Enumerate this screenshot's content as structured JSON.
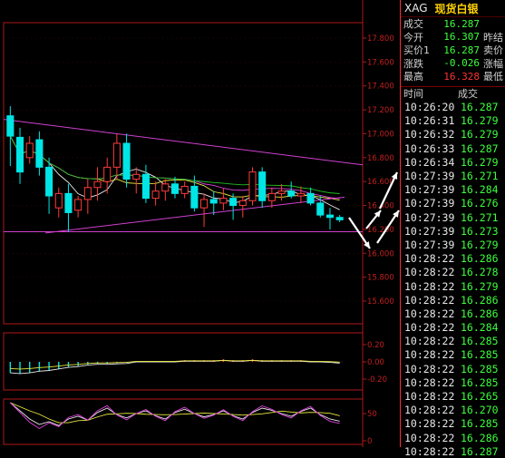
{
  "symbol": "XAG",
  "name": "现货白银",
  "quote": [
    {
      "label": "成交",
      "value": "16.287",
      "color": "#3dff3d",
      "right": ""
    },
    {
      "label": "今开",
      "value": "16.307",
      "color": "#3dff3d",
      "right": "昨结"
    },
    {
      "label": "买价1",
      "value": "16.287",
      "color": "#3dff3d",
      "right": "卖价"
    },
    {
      "label": "涨跌",
      "value": "-0.026",
      "color": "#3dff3d",
      "right": "涨幅"
    },
    {
      "label": "最高",
      "value": "16.328",
      "color": "#ff3333",
      "right": "最低"
    }
  ],
  "ticks_header": {
    "time": "时间",
    "price": "成交"
  },
  "ticks": [
    {
      "time": "10:26:20",
      "price": "16.287"
    },
    {
      "time": "10:26:31",
      "price": "16.279"
    },
    {
      "time": "10:26:32",
      "price": "16.279"
    },
    {
      "time": "10:26:33",
      "price": "16.287"
    },
    {
      "time": "10:26:34",
      "price": "16.279"
    },
    {
      "time": "10:27:39",
      "price": "16.271"
    },
    {
      "time": "10:27:39",
      "price": "16.284"
    },
    {
      "time": "10:27:39",
      "price": "16.276"
    },
    {
      "time": "10:27:39",
      "price": "16.271"
    },
    {
      "time": "10:27:39",
      "price": "16.273"
    },
    {
      "time": "10:27:39",
      "price": "16.279"
    },
    {
      "time": "10:28:22",
      "price": "16.286"
    },
    {
      "time": "10:28:22",
      "price": "16.278"
    },
    {
      "time": "10:28:22",
      "price": "16.279"
    },
    {
      "time": "10:28:22",
      "price": "16.286"
    },
    {
      "time": "10:28:22",
      "price": "16.286"
    },
    {
      "time": "10:28:22",
      "price": "16.284"
    },
    {
      "time": "10:28:22",
      "price": "16.285"
    },
    {
      "time": "10:28:22",
      "price": "16.285"
    },
    {
      "time": "10:28:22",
      "price": "16.285"
    },
    {
      "time": "10:28:22",
      "price": "16.285"
    },
    {
      "time": "10:28:22",
      "price": "16.265"
    },
    {
      "time": "10:28:22",
      "price": "16.270"
    },
    {
      "time": "10:28:22",
      "price": "16.285"
    },
    {
      "time": "10:28:22",
      "price": "16.286"
    },
    {
      "time": "10:28:22",
      "price": "16.287"
    }
  ],
  "price_axis": [
    "17.800",
    "17.600",
    "17.400",
    "17.200",
    "17.000",
    "16.800",
    "16.600",
    "16.400",
    "16.200",
    "16.000",
    "15.800",
    "15.600"
  ],
  "macd_axis": [
    "0.20",
    "0.00",
    "-0.20"
  ],
  "kdj_axis": [
    "50",
    "0"
  ],
  "colors": {
    "up": "#ff3b3b",
    "down": "#00e5e5",
    "border": "#b01818",
    "grid": "#7a1010",
    "ma1": "#e8e8e8",
    "ma2": "#e8e840",
    "ma3": "#e040e0",
    "ma4": "#20c020",
    "trend": "#d040d0"
  },
  "candles": [
    {
      "o": 17.15,
      "h": 17.23,
      "l": 16.73,
      "c": 16.98
    },
    {
      "o": 16.97,
      "h": 17.05,
      "l": 16.58,
      "c": 16.68
    },
    {
      "o": 16.8,
      "h": 16.98,
      "l": 16.75,
      "c": 16.92
    },
    {
      "o": 16.95,
      "h": 17.02,
      "l": 16.65,
      "c": 16.72
    },
    {
      "o": 16.72,
      "h": 16.8,
      "l": 16.33,
      "c": 16.48
    },
    {
      "o": 16.38,
      "h": 16.55,
      "l": 16.3,
      "c": 16.5
    },
    {
      "o": 16.5,
      "h": 16.58,
      "l": 16.18,
      "c": 16.34
    },
    {
      "o": 16.36,
      "h": 16.48,
      "l": 16.3,
      "c": 16.45
    },
    {
      "o": 16.45,
      "h": 16.62,
      "l": 16.33,
      "c": 16.55
    },
    {
      "o": 16.55,
      "h": 16.72,
      "l": 16.44,
      "c": 16.6
    },
    {
      "o": 16.6,
      "h": 16.8,
      "l": 16.5,
      "c": 16.72
    },
    {
      "o": 16.72,
      "h": 17.0,
      "l": 16.62,
      "c": 16.92
    },
    {
      "o": 16.92,
      "h": 17.0,
      "l": 16.55,
      "c": 16.62
    },
    {
      "o": 16.62,
      "h": 16.72,
      "l": 16.5,
      "c": 16.66
    },
    {
      "o": 16.66,
      "h": 16.74,
      "l": 16.42,
      "c": 16.46
    },
    {
      "o": 16.46,
      "h": 16.6,
      "l": 16.4,
      "c": 16.52
    },
    {
      "o": 16.52,
      "h": 16.62,
      "l": 16.44,
      "c": 16.58
    },
    {
      "o": 16.58,
      "h": 16.64,
      "l": 16.46,
      "c": 16.5
    },
    {
      "o": 16.5,
      "h": 16.6,
      "l": 16.46,
      "c": 16.56
    },
    {
      "o": 16.56,
      "h": 16.65,
      "l": 16.35,
      "c": 16.38
    },
    {
      "o": 16.38,
      "h": 16.5,
      "l": 16.22,
      "c": 16.45
    },
    {
      "o": 16.45,
      "h": 16.52,
      "l": 16.32,
      "c": 16.42
    },
    {
      "o": 16.42,
      "h": 16.54,
      "l": 16.36,
      "c": 16.46
    },
    {
      "o": 16.46,
      "h": 16.5,
      "l": 16.28,
      "c": 16.4
    },
    {
      "o": 16.4,
      "h": 16.48,
      "l": 16.3,
      "c": 16.44
    },
    {
      "o": 16.44,
      "h": 16.72,
      "l": 16.4,
      "c": 16.68
    },
    {
      "o": 16.68,
      "h": 16.72,
      "l": 16.38,
      "c": 16.44
    },
    {
      "o": 16.44,
      "h": 16.55,
      "l": 16.38,
      "c": 16.5
    },
    {
      "o": 16.5,
      "h": 16.58,
      "l": 16.44,
      "c": 16.52
    },
    {
      "o": 16.52,
      "h": 16.6,
      "l": 16.46,
      "c": 16.48
    },
    {
      "o": 16.48,
      "h": 16.56,
      "l": 16.42,
      "c": 16.5
    },
    {
      "o": 16.5,
      "h": 16.55,
      "l": 16.4,
      "c": 16.42
    },
    {
      "o": 16.42,
      "h": 16.48,
      "l": 16.3,
      "c": 16.32
    },
    {
      "o": 16.32,
      "h": 16.38,
      "l": 16.2,
      "c": 16.3
    },
    {
      "o": 16.3,
      "h": 16.32,
      "l": 16.26,
      "c": 16.28
    }
  ],
  "macd_bars": [
    -0.13,
    -0.14,
    -0.13,
    -0.11,
    -0.1,
    -0.08,
    -0.06,
    -0.05,
    -0.03,
    -0.02,
    -0.02,
    -0.015,
    -0.01,
    0.01,
    0.01,
    0.01,
    0.01,
    0.01,
    0.02,
    0.02,
    0.02,
    0.02,
    0.03,
    0.02,
    0.02,
    0.03,
    0.02,
    0.02,
    0.02,
    0.02,
    0.02,
    0.01,
    0.01,
    0.005,
    -0.005
  ]
}
